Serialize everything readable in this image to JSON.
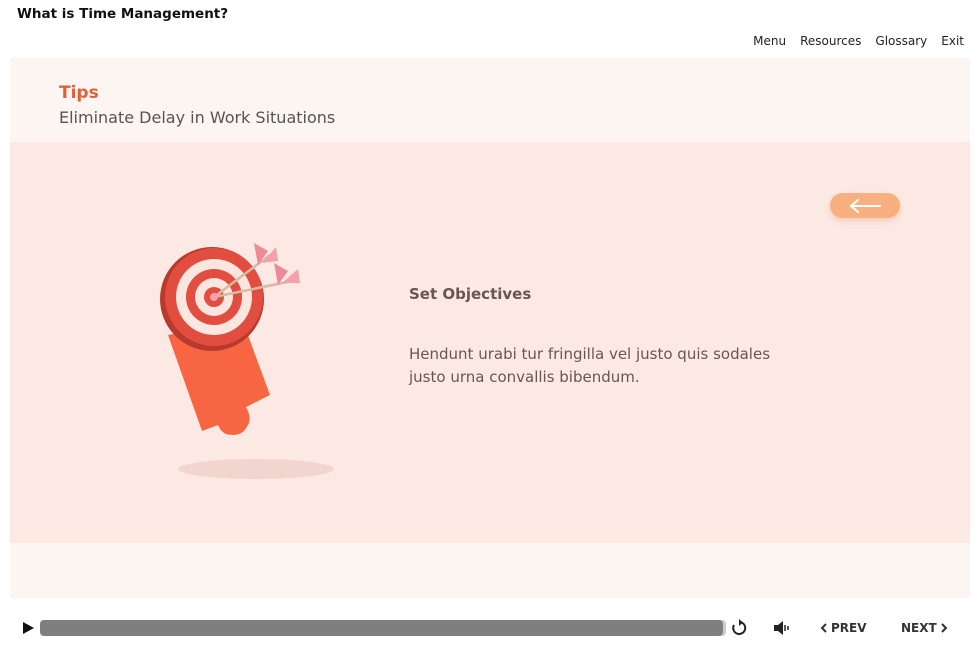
{
  "app": {
    "title": "What is Time Management?"
  },
  "nav": {
    "items": [
      "Menu",
      "Resources",
      "Glossary",
      "Exit"
    ]
  },
  "slide": {
    "section": "Tips",
    "subtitle": "Eliminate Delay in Work Situations",
    "back_icon": "arrow-left-icon",
    "illustration": "target-puzzle-illustration",
    "objective_title": "Set Objectives",
    "objective_body": "Hendunt urabi tur fringilla vel justo quis sodales justo urna convallis bibendum."
  },
  "player": {
    "play_icon": "play-icon",
    "progress_fraction": 0.996,
    "replay_icon": "replay-icon",
    "volume_icon": "volume-icon",
    "prev_label": "PREV",
    "next_label": "NEXT"
  },
  "colors": {
    "accent": "#e0603d",
    "panel": "#fde9e3",
    "slide_bg": "#fdf5f2",
    "back_button": "#f9b080",
    "text_body": "#6a5651",
    "progress": "#7f7f7f"
  }
}
